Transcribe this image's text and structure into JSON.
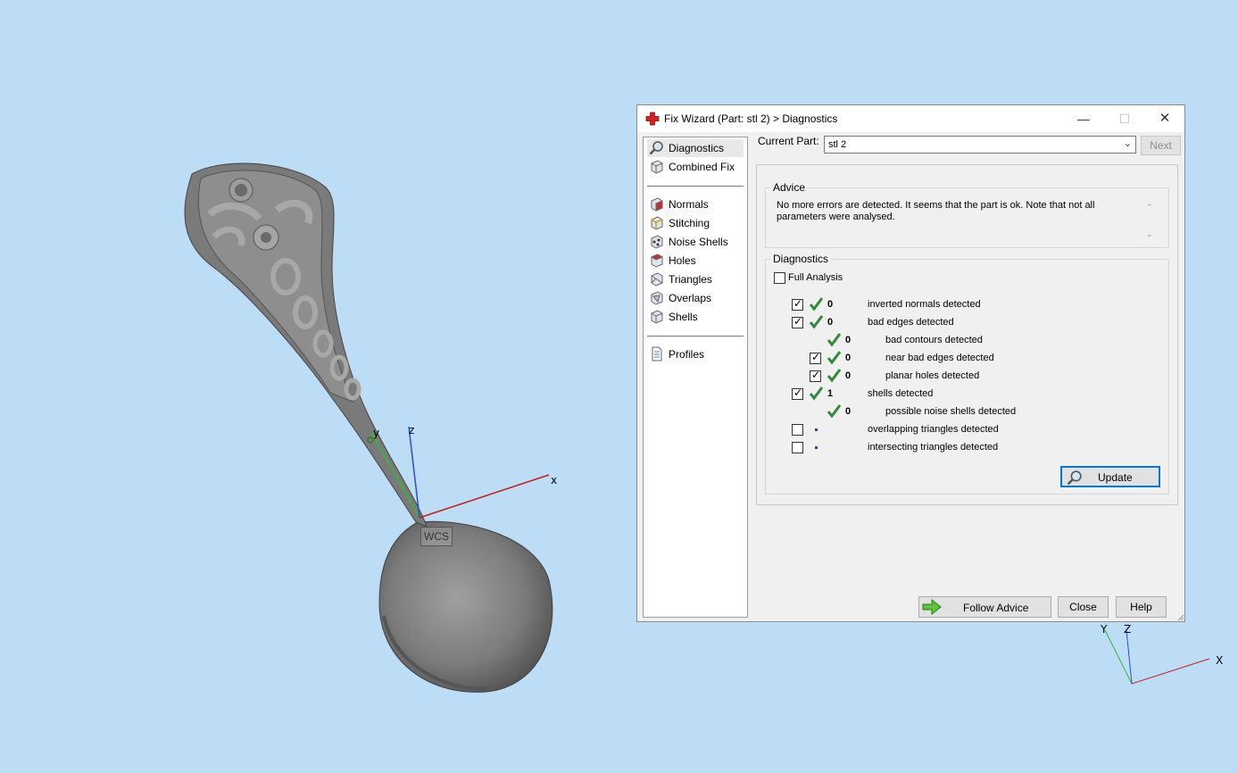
{
  "viewport": {
    "wcs_label": "WCS",
    "axis_x": "x",
    "axis_y": "y",
    "axis_z": "z",
    "corner_axis_x": "X",
    "corner_axis_y": "Y",
    "corner_axis_z": "Z"
  },
  "dialog": {
    "title": "Fix Wizard (Part: stl 2) > Diagnostics",
    "window_buttons": {
      "minimize": "—",
      "maximize": "☐",
      "close": "✕"
    },
    "nav": {
      "items": [
        {
          "label": "Diagnostics",
          "icon": "magnifier-icon",
          "selected": true
        },
        {
          "label": "Combined Fix",
          "icon": "cube-icon"
        },
        {
          "label": "Normals",
          "icon": "normals-cube-icon"
        },
        {
          "label": "Stitching",
          "icon": "stitching-cube-icon"
        },
        {
          "label": "Noise Shells",
          "icon": "noise-shells-icon"
        },
        {
          "label": "Holes",
          "icon": "holes-cube-icon"
        },
        {
          "label": "Triangles",
          "icon": "triangles-cube-icon"
        },
        {
          "label": "Overlaps",
          "icon": "overlaps-cube-icon"
        },
        {
          "label": "Shells",
          "icon": "shells-cube-icon"
        },
        {
          "label": "Profiles",
          "icon": "profiles-document-icon"
        }
      ]
    },
    "current_part_label": "Current Part:",
    "current_part_value": "stl 2",
    "next_label": "Next",
    "advice": {
      "title": "Advice",
      "text": "No more errors are detected. It seems that the part is ok. Note that not all parameters were analysed."
    },
    "diagnostics": {
      "title": "Diagnostics",
      "full_analysis_label": "Full Analysis",
      "full_analysis_checked": false,
      "rows": [
        {
          "checkbox": true,
          "checked": true,
          "status": "ok",
          "count": "0",
          "text": "inverted normals detected",
          "indent": 0
        },
        {
          "checkbox": true,
          "checked": true,
          "status": "ok",
          "count": "0",
          "text": "bad edges detected",
          "indent": 0
        },
        {
          "checkbox": false,
          "checked": false,
          "status": "ok",
          "count": "0",
          "text": "bad contours detected",
          "indent": 1
        },
        {
          "checkbox": true,
          "checked": true,
          "status": "ok",
          "count": "0",
          "text": "near bad edges detected",
          "indent": 1
        },
        {
          "checkbox": true,
          "checked": true,
          "status": "ok",
          "count": "0",
          "text": "planar holes detected",
          "indent": 1
        },
        {
          "checkbox": true,
          "checked": true,
          "status": "ok",
          "count": "1",
          "text": "shells detected",
          "indent": 0
        },
        {
          "checkbox": false,
          "checked": false,
          "status": "ok",
          "count": "0",
          "text": "possible noise shells detected",
          "indent": 1
        },
        {
          "checkbox": true,
          "checked": false,
          "status": "unknown",
          "count": "",
          "text": "overlapping triangles detected",
          "indent": 0
        },
        {
          "checkbox": true,
          "checked": false,
          "status": "unknown",
          "count": "",
          "text": "intersecting triangles detected",
          "indent": 0
        }
      ],
      "update_label": "Update"
    },
    "footer": {
      "follow_advice_label": "Follow Advice",
      "close_label": "Close",
      "help_label": "Help"
    },
    "colors": {
      "accent": "#0078d7",
      "check_green": "#2e8b3a",
      "unknown_dot": "#1f3fd4"
    }
  }
}
